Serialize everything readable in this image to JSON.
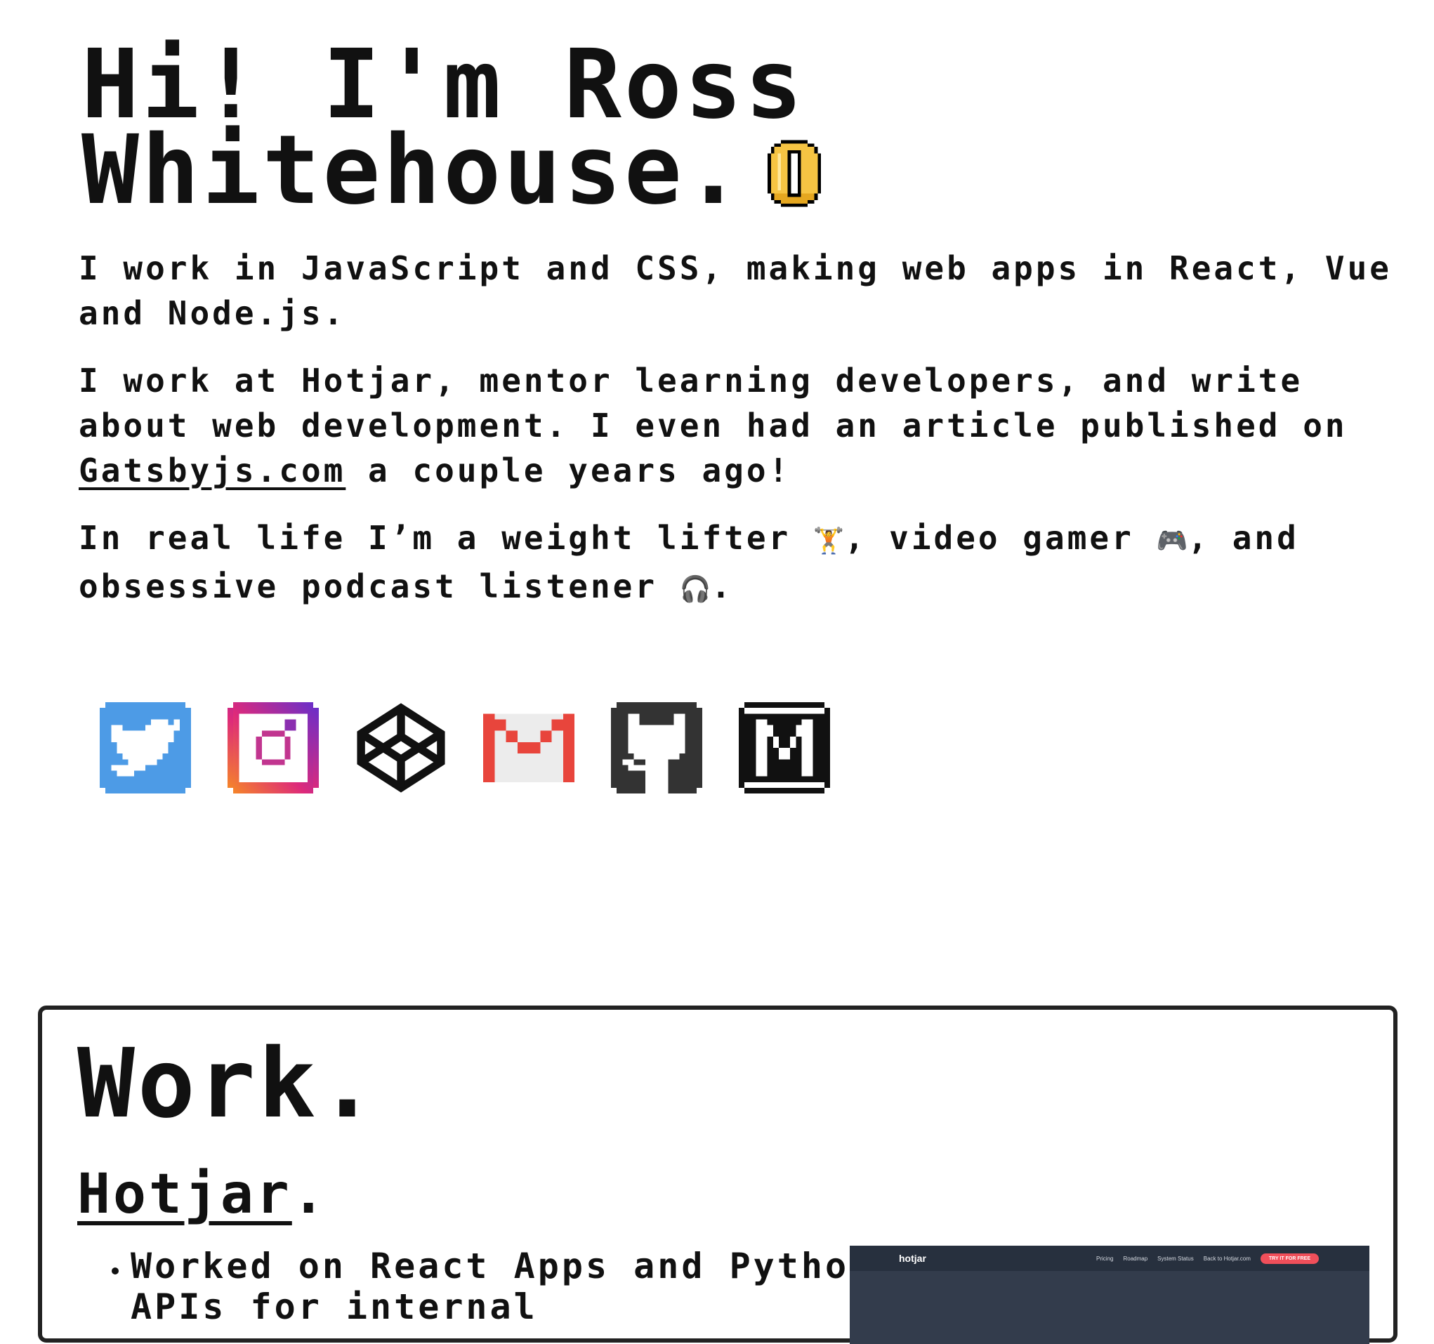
{
  "hero": {
    "title_line1": "Hi! I'm Ross",
    "title_line2": "Whitehouse."
  },
  "intro": {
    "p1": "I work in JavaScript and CSS, making web apps in React, Vue and Node.js.",
    "p2_before": "I work at Hotjar, mentor learning developers, and write about web development. I even had an article published on ",
    "p2_link": "Gatsbyjs.com",
    "p2_after": " a couple years ago!",
    "p3_part1": "In real life I’m a weight lifter ",
    "p3_emoji1": "🏋️",
    "p3_part2": ", video gamer ",
    "p3_emoji2": "🎮",
    "p3_part3": ", and obsessive podcast listener ",
    "p3_emoji3": "🎧",
    "p3_part4": "."
  },
  "socials": [
    {
      "name": "twitter",
      "icon": "twitter-icon",
      "color": "#4d9be6"
    },
    {
      "name": "instagram",
      "icon": "instagram-icon",
      "color": "#c13584"
    },
    {
      "name": "codepen",
      "icon": "codepen-icon",
      "color": "#111111"
    },
    {
      "name": "gmail",
      "icon": "gmail-icon",
      "color": "#e8453c"
    },
    {
      "name": "github",
      "icon": "github-icon",
      "color": "#333333"
    },
    {
      "name": "medium",
      "icon": "medium-icon",
      "color": "#111111"
    }
  ],
  "work": {
    "heading": "Work.",
    "company": "Hotjar",
    "company_suffix": ".",
    "bullets": [
      "Worked on React Apps and Python APIs for internal"
    ],
    "screenshot": {
      "logo": "hotjar",
      "nav": [
        "Pricing",
        "Roadmap",
        "System Status",
        "Back to Hotjar.com"
      ],
      "cta": "TRY IT FOR FREE"
    }
  }
}
